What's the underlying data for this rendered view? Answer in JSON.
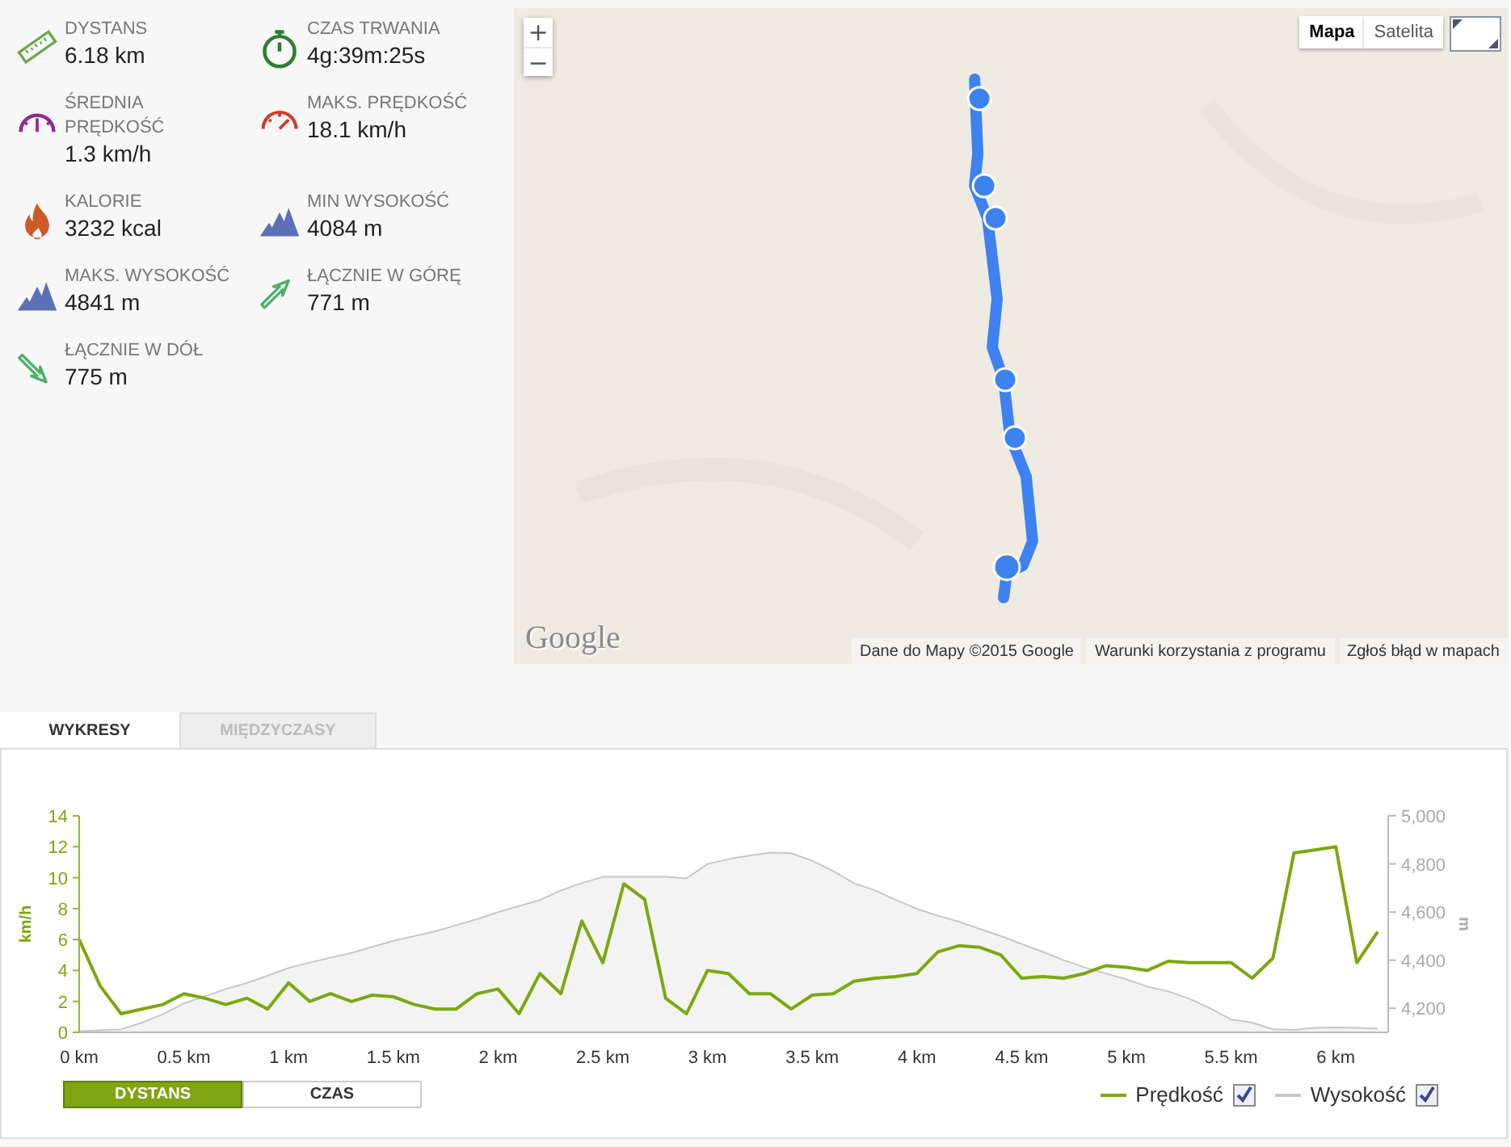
{
  "stats": [
    {
      "kind": "ruler",
      "label": "DYSTANS",
      "value": "6.18 km"
    },
    {
      "kind": "stopwatch",
      "label": "CZAS TRWANIA",
      "value": "4g:39m:25s"
    },
    {
      "kind": "gauge-avg",
      "label": "ŚREDNIA PRĘDKOŚĆ",
      "value": "1.3 km/h"
    },
    {
      "kind": "gauge-max",
      "label": "MAKS. PRĘDKOŚĆ",
      "value": "18.1 km/h"
    },
    {
      "kind": "flame",
      "label": "KALORIE",
      "value": "3232 kcal"
    },
    {
      "kind": "mountains",
      "label": "MIN WYSOKOŚĆ",
      "value": "4084 m"
    },
    {
      "kind": "mountains",
      "label": "MAKS. WYSOKOŚĆ",
      "value": "4841 m"
    },
    {
      "kind": "arrow-up",
      "label": "ŁĄCZNIE W GÓRĘ",
      "value": "771 m"
    },
    {
      "kind": "arrow-down",
      "label": "ŁĄCZNIE W DÓŁ",
      "value": "775 m"
    }
  ],
  "map": {
    "kind": "picture",
    "zoom_in": "+",
    "zoom_out": "−",
    "types": [
      {
        "label": "Mapa",
        "selected": true
      },
      {
        "label": "Satelita",
        "selected": false
      }
    ],
    "logo": "Google",
    "attribution": [
      "Dane do Mapy ©2015 Google",
      "Warunki korzystania z programu",
      "Zgłoś błąd w mapach"
    ]
  },
  "tabs": [
    {
      "label": "WYKRESY",
      "selected": true
    },
    {
      "label": "MIĘDZYCZASY",
      "selected": false
    }
  ],
  "chart_data": {
    "type": "line",
    "ylabel": "km/h",
    "y2label": "m",
    "x": [
      0,
      0.1,
      0.2,
      0.3,
      0.4,
      0.5,
      0.6,
      0.7,
      0.8,
      0.9,
      1.0,
      1.1,
      1.2,
      1.3,
      1.4,
      1.5,
      1.6,
      1.7,
      1.8,
      1.9,
      2.0,
      2.1,
      2.2,
      2.3,
      2.4,
      2.5,
      2.6,
      2.7,
      2.8,
      2.9,
      3.0,
      3.1,
      3.2,
      3.3,
      3.4,
      3.5,
      3.6,
      3.7,
      3.8,
      3.9,
      4.0,
      4.1,
      4.2,
      4.3,
      4.4,
      4.5,
      4.6,
      4.7,
      4.8,
      4.9,
      5.0,
      5.1,
      5.2,
      5.3,
      5.4,
      5.5,
      5.6,
      5.7,
      5.8,
      5.9,
      6.0,
      6.1,
      6.2
    ],
    "xlim": [
      0,
      6.25
    ],
    "ylim": [
      0,
      14
    ],
    "y2lim": [
      4100,
      5000
    ],
    "xticks": [
      {
        "value": 0,
        "label": "0 km"
      },
      {
        "value": 0.5,
        "label": "0.5 km"
      },
      {
        "value": 1,
        "label": "1 km"
      },
      {
        "value": 1.5,
        "label": "1.5 km"
      },
      {
        "value": 2,
        "label": "2 km"
      },
      {
        "value": 2.5,
        "label": "2.5 km"
      },
      {
        "value": 3,
        "label": "3 km"
      },
      {
        "value": 3.5,
        "label": "3.5 km"
      },
      {
        "value": 4,
        "label": "4 km"
      },
      {
        "value": 4.5,
        "label": "4.5 km"
      },
      {
        "value": 5,
        "label": "5 km"
      },
      {
        "value": 5.5,
        "label": "5.5 km"
      },
      {
        "value": 6,
        "label": "6 km"
      }
    ],
    "yticks": [
      0,
      2,
      4,
      6,
      8,
      10,
      12,
      14
    ],
    "y2ticks": [
      {
        "value": 4200,
        "label": "4,200"
      },
      {
        "value": 4400,
        "label": "4,400"
      },
      {
        "value": 4600,
        "label": "4,600"
      },
      {
        "value": 4800,
        "label": "4,800"
      },
      {
        "value": 5000,
        "label": "5,000"
      }
    ],
    "series": [
      {
        "name": "Prędkość",
        "color": "#7ea70f",
        "values": [
          6,
          3,
          1.2,
          1.5,
          1.8,
          2.5,
          2.2,
          1.8,
          2.2,
          1.5,
          3.2,
          2,
          2.5,
          2,
          2.4,
          2.3,
          1.8,
          1.5,
          1.5,
          2.5,
          2.8,
          1.2,
          3.8,
          2.5,
          7.2,
          4.5,
          9.6,
          8.6,
          2.2,
          1.2,
          4,
          3.8,
          2.5,
          2.5,
          1.5,
          2.4,
          2.5,
          3.3,
          3.5,
          3.6,
          3.8,
          5.2,
          5.6,
          5.5,
          5,
          3.5,
          3.6,
          3.5,
          3.8,
          4.3,
          4.2,
          4,
          4.6,
          4.5,
          4.5,
          4.5,
          3.5,
          4.8,
          11.6,
          11.8,
          12,
          4.5,
          6.5
        ]
      },
      {
        "name": "Wysokość",
        "color": "#c8c8c8",
        "axis": "y2",
        "values": [
          4105,
          4108,
          4112,
          4140,
          4175,
          4220,
          4250,
          4280,
          4305,
          4335,
          4367,
          4390,
          4410,
          4430,
          4455,
          4480,
          4500,
          4520,
          4545,
          4570,
          4600,
          4625,
          4650,
          4690,
          4720,
          4747,
          4747,
          4747,
          4747,
          4740,
          4800,
          4820,
          4835,
          4847,
          4845,
          4813,
          4770,
          4720,
          4690,
          4650,
          4613,
          4585,
          4560,
          4530,
          4500,
          4467,
          4435,
          4400,
          4370,
          4345,
          4320,
          4290,
          4270,
          4240,
          4200,
          4153,
          4140,
          4113,
          4110,
          4118,
          4120,
          4118,
          4115
        ]
      }
    ]
  },
  "axis_toggle": [
    {
      "label": "DYSTANS",
      "selected": true
    },
    {
      "label": "CZAS",
      "selected": false
    }
  ],
  "legend": [
    {
      "checked": true
    },
    {
      "checked": true
    }
  ]
}
